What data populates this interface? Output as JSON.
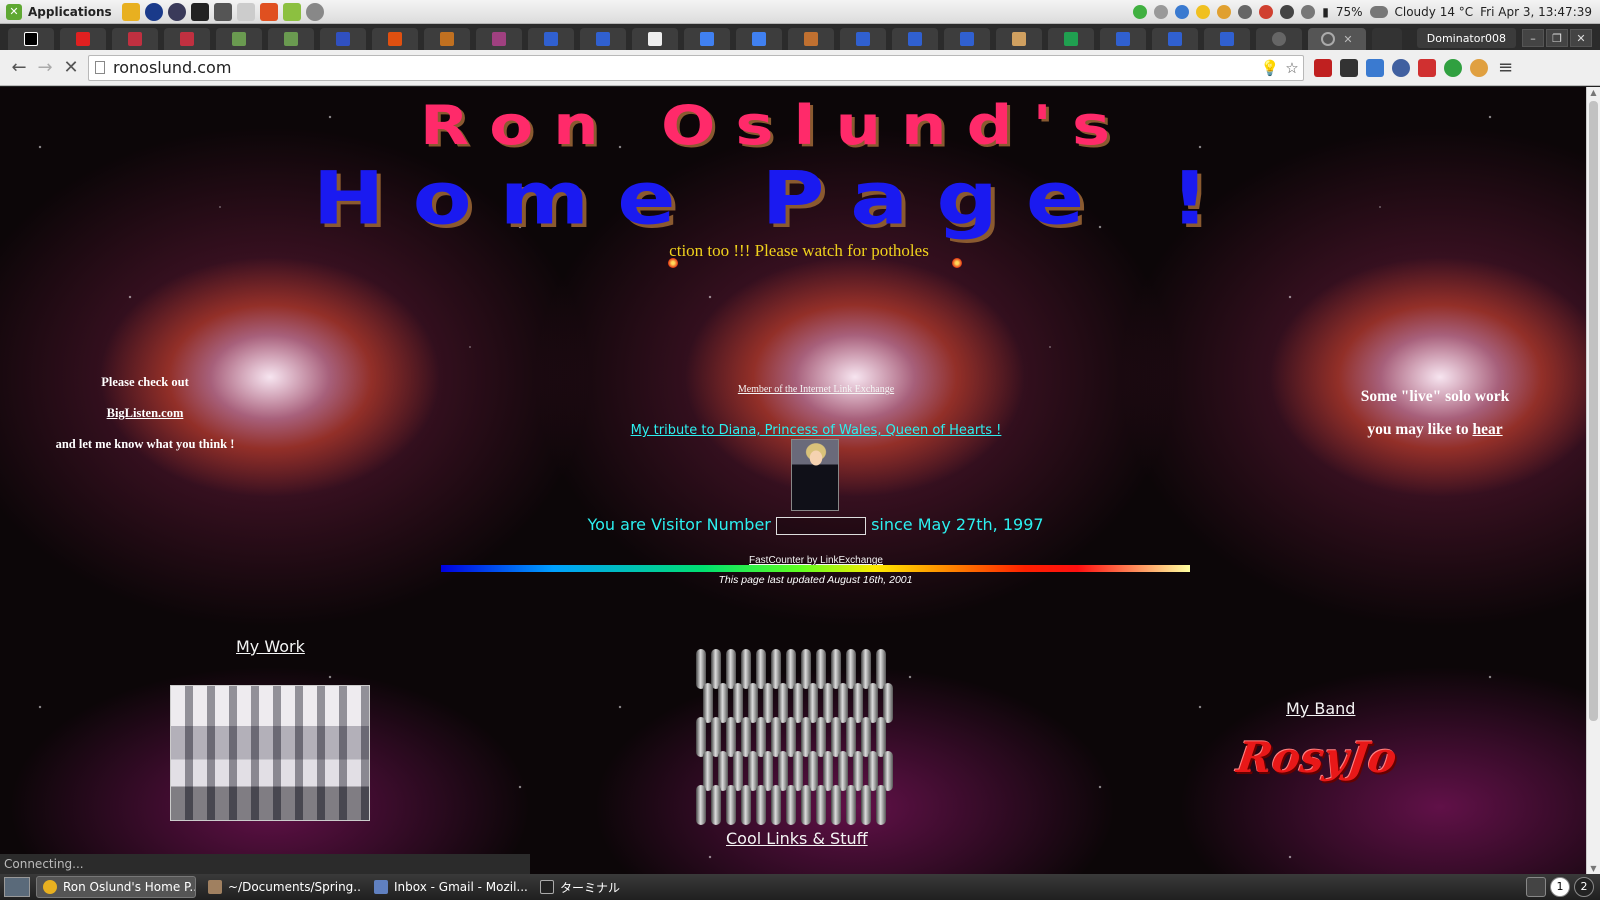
{
  "os_panel": {
    "applications_label": "Applications",
    "battery": "75%",
    "weather": "Cloudy 14 °C",
    "clock": "Fri Apr  3, 13:47:39"
  },
  "browser": {
    "profile_name": "Dominator008",
    "url": "ronoslund.com",
    "status_text": "Connecting..."
  },
  "page": {
    "title_line1": "Ron Oslund's",
    "title_line2": "Home Page !",
    "marquee_text": "ction too !!! Please watch for potholes",
    "left_promo": {
      "line1": "Please check out",
      "link": "BigListen.com",
      "line2": "and let me know what you think !"
    },
    "link_exchange": "Member of the Internet Link Exchange",
    "tribute_link": "My tribute to Diana, Princess of Wales, Queen of Hearts !",
    "visitor_prefix": "You are Visitor Number",
    "visitor_suffix": "since May 27th, 1997",
    "fastcounter": "FastCounter by LinkExchange",
    "updated": "This page last updated August 16th, 2001",
    "right_promo": {
      "line1": "Some \"live\" solo work",
      "line2_pre": "you may like to ",
      "line2_link": "hear"
    },
    "my_work": "My Work",
    "cool_links": "Cool Links & Stuff",
    "my_band": "My Band",
    "band_logo": "RosyJo"
  },
  "taskbar": {
    "tasks": [
      {
        "label": "Ron Oslund's Home P..."
      },
      {
        "label": "~/Documents/Spring..."
      },
      {
        "label": "Inbox - Gmail - Mozil..."
      },
      {
        "label": "ターミナル"
      }
    ],
    "workspaces": [
      "1",
      "2"
    ]
  },
  "colors": {
    "title1": "#ff2a6a",
    "title2": "#1a1af0",
    "marquee": "#f0d21c",
    "cyan": "#2cf0f0",
    "band_logo": "#e81818"
  }
}
